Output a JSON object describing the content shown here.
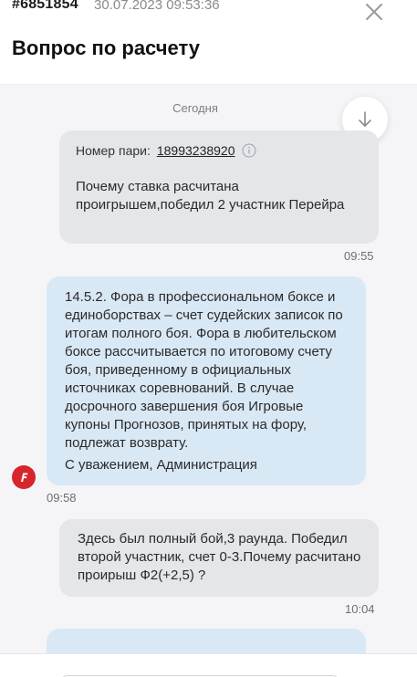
{
  "header": {
    "ticket_id": "#6851854",
    "datetime": "30.07.2023 09:53:36",
    "title": "Вопрос по расчету",
    "close_icon": "close-icon"
  },
  "chat": {
    "day_label": "Сегодня",
    "scroll_down_icon": "arrow-down-icon",
    "messages": [
      {
        "author": "user",
        "bet_label": "Номер пари:",
        "bet_number": "18993238920",
        "text": "Почему ставка расчитана проигрышем,победил   2 участник Перейра",
        "time": "09:55"
      },
      {
        "author": "admin",
        "avatar_letter": "F",
        "text": "14.5.2. Фора в профессиональном боксе и единоборствах – счет судейских записок по итогам полного боя. Фора в любительском боксе рассчитывается по итоговому счету боя, приведенному в официальных источниках соревнований. В случае досрочного завершения боя Игровые купоны Прогнозов, принятых на фору, подлежат возврату.",
        "signature": "С уважением, Администрация",
        "time": "09:58"
      },
      {
        "author": "user",
        "text": "Здесь был полный бой,3 раунда. Победил второй участник, счет  0-3.Почему расчитано  проирыш Ф2(+2,5) ?",
        "time": "10:04"
      }
    ]
  },
  "colors": {
    "user_bubble": "#e5e6ea",
    "admin_bubble": "#d9e8f5",
    "brand_red": "#d6252c"
  }
}
